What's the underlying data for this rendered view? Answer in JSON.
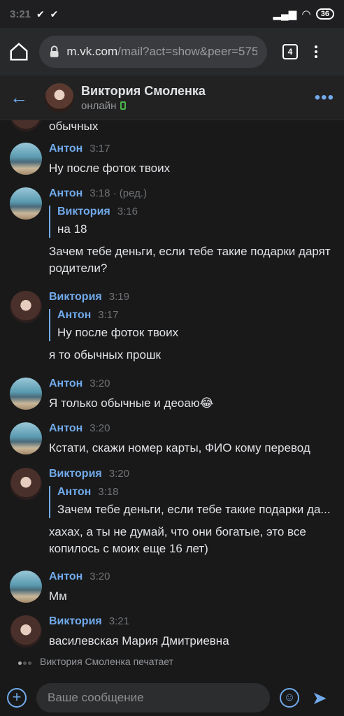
{
  "status_bar": {
    "time": "3:21",
    "checks": "✔ ✔",
    "battery": "36"
  },
  "browser": {
    "url_host": "m.vk.com",
    "url_path": "/mail?act=show&peer=5752",
    "tabs": "4"
  },
  "header": {
    "name": "Виктория Смоленка",
    "status": "онлайн"
  },
  "messages": [
    {
      "text": "обычных"
    },
    {
      "author": "Антон",
      "time": "3:17",
      "text": "Ну после фоток твоих"
    },
    {
      "author": "Антон",
      "time": "3:18 · (ред.)",
      "reply_author": "Виктория",
      "reply_time": "3:16",
      "reply_text": "на 18",
      "text": "Зачем тебе деньги, если тебе такие подарки дарят родители?"
    },
    {
      "author": "Виктория",
      "time": "3:19",
      "reply_author": "Антон",
      "reply_time": "3:17",
      "reply_text": "Ну после фоток твоих",
      "text": "я то обычных прошк"
    },
    {
      "author": "Антон",
      "time": "3:20",
      "text": "Я только обычные и деоаю😂"
    },
    {
      "author": "Антон",
      "time": "3:20",
      "text": "Кстати, скажи номер карты, ФИО кому перевод"
    },
    {
      "author": "Виктория",
      "time": "3:20",
      "reply_author": "Антон",
      "reply_time": "3:18",
      "reply_text": "Зачем тебе деньги, если тебе такие подарки да...",
      "text": "хахах, а ты не думай, что они богатые, это все копилось с моих еще 16 лет)"
    },
    {
      "author": "Антон",
      "time": "3:20",
      "text": "Мм"
    },
    {
      "author": "Виктория",
      "time": "3:21",
      "text": "василевская Мария Дмитриевна"
    }
  ],
  "typing": "Виктория Смоленка печатает",
  "composer": {
    "placeholder": "Ваше сообщение"
  }
}
